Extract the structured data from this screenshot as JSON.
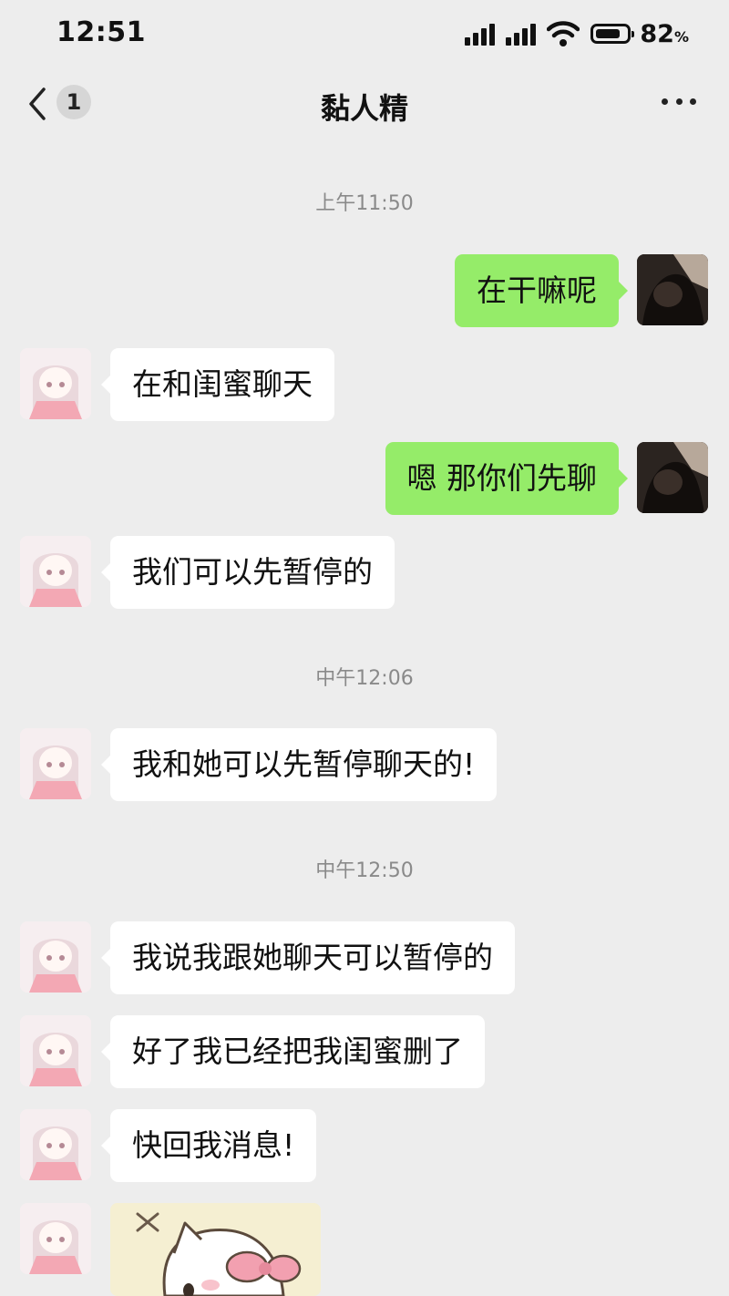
{
  "status_bar": {
    "time": "12:51",
    "battery_pct": "82",
    "battery_unit": "%",
    "battery_level": 0.82
  },
  "nav": {
    "unread_count": "1",
    "title": "黏人精"
  },
  "messages": {
    "ts1": "上午11:50",
    "m1": "在干嘛呢",
    "m2": "在和闺蜜聊天",
    "m3": "嗯 那你们先聊",
    "m4": "我们可以先暂停的",
    "ts2": "中午12:06",
    "m5": "我和她可以先暂停聊天的!",
    "ts3": "中午12:50",
    "m6": "我说我跟她聊天可以暂停的",
    "m7": "好了我已经把我闺蜜删了",
    "m8": "快回我消息!"
  },
  "icons": [
    "signal-icon",
    "wifi-icon",
    "battery-icon",
    "back-chevron-icon",
    "more-icon"
  ],
  "colors": {
    "background": "#ededed",
    "outgoing_bubble": "#95ec69",
    "incoming_bubble": "#ffffff",
    "timestamp": "#8a8a8a"
  }
}
